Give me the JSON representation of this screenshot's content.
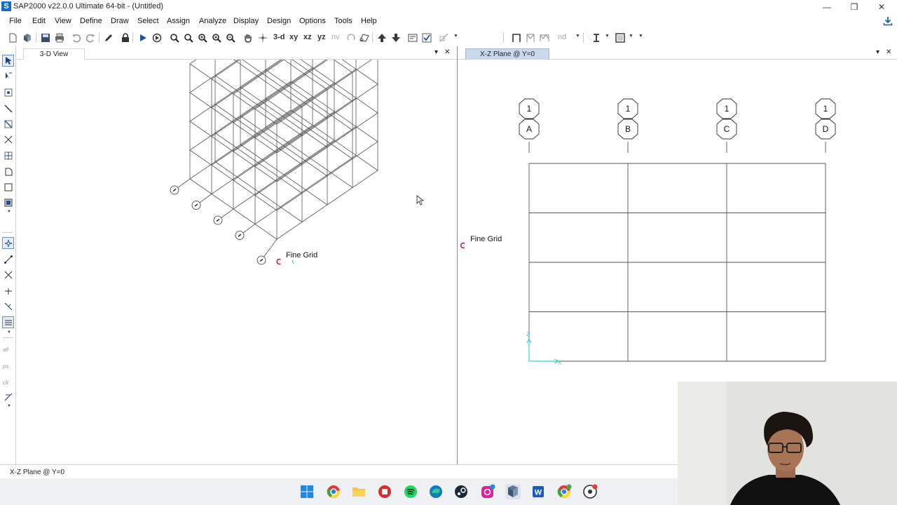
{
  "window": {
    "title": "SAP2000 v22.0.0 Ultimate 64-bit - (Untitled)",
    "app_icon_letter": "S",
    "minimize": "—",
    "restore": "❐",
    "close": "✕"
  },
  "menu": [
    "File",
    "Edit",
    "View",
    "Define",
    "Draw",
    "Select",
    "Assign",
    "Analyze",
    "Display",
    "Design",
    "Options",
    "Tools",
    "Help"
  ],
  "toolbar": {
    "view_3d": "3-d",
    "view_xy": "xy",
    "view_xz": "xz",
    "view_yz": "yz",
    "view_nv": "nv",
    "nd_label": "nd"
  },
  "left_toolbar_text": {
    "all": "all",
    "ps": "ps",
    "clr": "clr"
  },
  "left_panel": {
    "tab_label": "3-D View",
    "grid_label": "Fine Grid",
    "tab_menu": "▾",
    "tab_close": "✕"
  },
  "right_panel": {
    "tab_label": "X-Z Plane @ Y=0",
    "grid_label": "Fine Grid",
    "bubble_top": [
      "1",
      "1",
      "1",
      "1"
    ],
    "bubble_bottom": [
      "A",
      "B",
      "C",
      "D"
    ],
    "axis_z": "Z",
    "axis_x": "X",
    "tab_menu": "▾",
    "tab_close": "✕"
  },
  "status": {
    "text": "X-Z Plane @ Y=0"
  },
  "taskbar_icons": [
    "windows-start-icon",
    "chrome-icon",
    "file-explorer-icon",
    "app-red-icon",
    "spotify-icon",
    "edge-icon",
    "steam-icon",
    "instagram-icon",
    "sap2000-taskbar-icon",
    "word-icon",
    "chrome-profile-icon",
    "obs-icon"
  ],
  "colors": {
    "accent_tab": "#c9d9f0",
    "grid_line": "#555555",
    "origin_marker": "#d0143c",
    "axis": "#3fd0d0"
  }
}
